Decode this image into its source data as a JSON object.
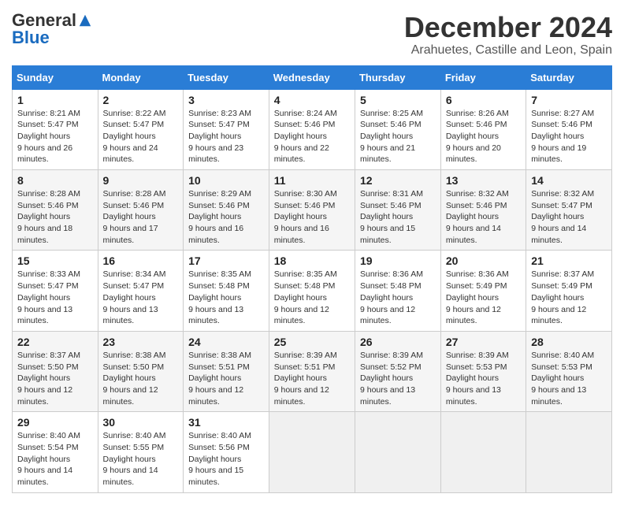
{
  "logo": {
    "general": "General",
    "blue": "Blue"
  },
  "title": "December 2024",
  "location": "Arahuetes, Castille and Leon, Spain",
  "weekdays": [
    "Sunday",
    "Monday",
    "Tuesday",
    "Wednesday",
    "Thursday",
    "Friday",
    "Saturday"
  ],
  "weeks": [
    [
      {
        "day": "1",
        "sunrise": "8:21 AM",
        "sunset": "5:47 PM",
        "daylight": "9 hours and 26 minutes."
      },
      {
        "day": "2",
        "sunrise": "8:22 AM",
        "sunset": "5:47 PM",
        "daylight": "9 hours and 24 minutes."
      },
      {
        "day": "3",
        "sunrise": "8:23 AM",
        "sunset": "5:47 PM",
        "daylight": "9 hours and 23 minutes."
      },
      {
        "day": "4",
        "sunrise": "8:24 AM",
        "sunset": "5:46 PM",
        "daylight": "9 hours and 22 minutes."
      },
      {
        "day": "5",
        "sunrise": "8:25 AM",
        "sunset": "5:46 PM",
        "daylight": "9 hours and 21 minutes."
      },
      {
        "day": "6",
        "sunrise": "8:26 AM",
        "sunset": "5:46 PM",
        "daylight": "9 hours and 20 minutes."
      },
      {
        "day": "7",
        "sunrise": "8:27 AM",
        "sunset": "5:46 PM",
        "daylight": "9 hours and 19 minutes."
      }
    ],
    [
      {
        "day": "8",
        "sunrise": "8:28 AM",
        "sunset": "5:46 PM",
        "daylight": "9 hours and 18 minutes."
      },
      {
        "day": "9",
        "sunrise": "8:28 AM",
        "sunset": "5:46 PM",
        "daylight": "9 hours and 17 minutes."
      },
      {
        "day": "10",
        "sunrise": "8:29 AM",
        "sunset": "5:46 PM",
        "daylight": "9 hours and 16 minutes."
      },
      {
        "day": "11",
        "sunrise": "8:30 AM",
        "sunset": "5:46 PM",
        "daylight": "9 hours and 16 minutes."
      },
      {
        "day": "12",
        "sunrise": "8:31 AM",
        "sunset": "5:46 PM",
        "daylight": "9 hours and 15 minutes."
      },
      {
        "day": "13",
        "sunrise": "8:32 AM",
        "sunset": "5:46 PM",
        "daylight": "9 hours and 14 minutes."
      },
      {
        "day": "14",
        "sunrise": "8:32 AM",
        "sunset": "5:47 PM",
        "daylight": "9 hours and 14 minutes."
      }
    ],
    [
      {
        "day": "15",
        "sunrise": "8:33 AM",
        "sunset": "5:47 PM",
        "daylight": "9 hours and 13 minutes."
      },
      {
        "day": "16",
        "sunrise": "8:34 AM",
        "sunset": "5:47 PM",
        "daylight": "9 hours and 13 minutes."
      },
      {
        "day": "17",
        "sunrise": "8:35 AM",
        "sunset": "5:48 PM",
        "daylight": "9 hours and 13 minutes."
      },
      {
        "day": "18",
        "sunrise": "8:35 AM",
        "sunset": "5:48 PM",
        "daylight": "9 hours and 12 minutes."
      },
      {
        "day": "19",
        "sunrise": "8:36 AM",
        "sunset": "5:48 PM",
        "daylight": "9 hours and 12 minutes."
      },
      {
        "day": "20",
        "sunrise": "8:36 AM",
        "sunset": "5:49 PM",
        "daylight": "9 hours and 12 minutes."
      },
      {
        "day": "21",
        "sunrise": "8:37 AM",
        "sunset": "5:49 PM",
        "daylight": "9 hours and 12 minutes."
      }
    ],
    [
      {
        "day": "22",
        "sunrise": "8:37 AM",
        "sunset": "5:50 PM",
        "daylight": "9 hours and 12 minutes."
      },
      {
        "day": "23",
        "sunrise": "8:38 AM",
        "sunset": "5:50 PM",
        "daylight": "9 hours and 12 minutes."
      },
      {
        "day": "24",
        "sunrise": "8:38 AM",
        "sunset": "5:51 PM",
        "daylight": "9 hours and 12 minutes."
      },
      {
        "day": "25",
        "sunrise": "8:39 AM",
        "sunset": "5:51 PM",
        "daylight": "9 hours and 12 minutes."
      },
      {
        "day": "26",
        "sunrise": "8:39 AM",
        "sunset": "5:52 PM",
        "daylight": "9 hours and 13 minutes."
      },
      {
        "day": "27",
        "sunrise": "8:39 AM",
        "sunset": "5:53 PM",
        "daylight": "9 hours and 13 minutes."
      },
      {
        "day": "28",
        "sunrise": "8:40 AM",
        "sunset": "5:53 PM",
        "daylight": "9 hours and 13 minutes."
      }
    ],
    [
      {
        "day": "29",
        "sunrise": "8:40 AM",
        "sunset": "5:54 PM",
        "daylight": "9 hours and 14 minutes."
      },
      {
        "day": "30",
        "sunrise": "8:40 AM",
        "sunset": "5:55 PM",
        "daylight": "9 hours and 14 minutes."
      },
      {
        "day": "31",
        "sunrise": "8:40 AM",
        "sunset": "5:56 PM",
        "daylight": "9 hours and 15 minutes."
      },
      null,
      null,
      null,
      null
    ]
  ]
}
